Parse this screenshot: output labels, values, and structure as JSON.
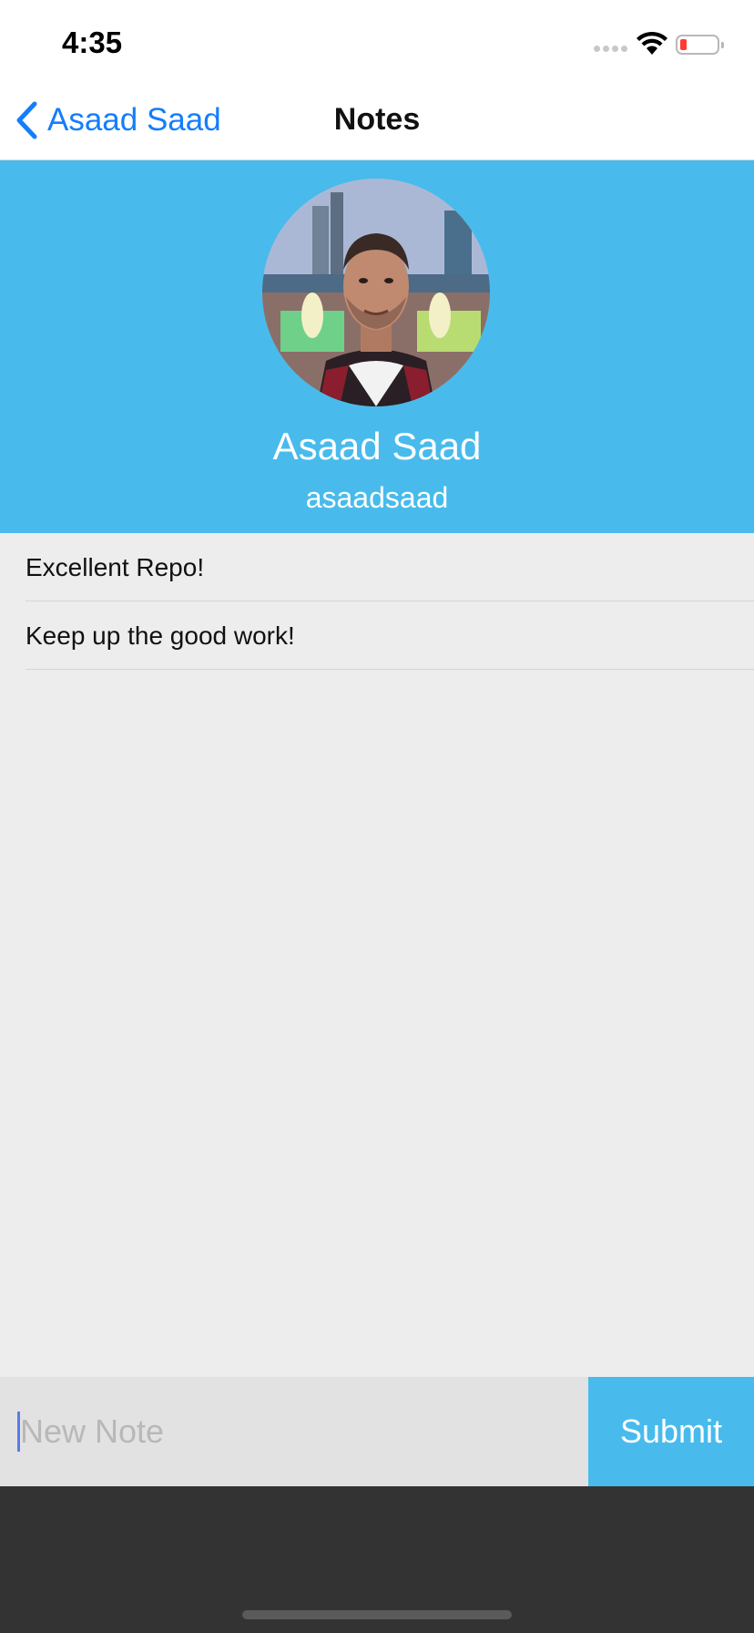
{
  "status_bar": {
    "time": "4:35",
    "icons": [
      "signal-dots-icon",
      "wifi-icon",
      "battery-low-icon"
    ]
  },
  "nav": {
    "back_label": "Asaad Saad",
    "back_icon": "chevron-left-icon",
    "title": "Notes"
  },
  "profile": {
    "name": "Asaad Saad",
    "username": "asaadsaad"
  },
  "notes": [
    {
      "text": "Excellent Repo!"
    },
    {
      "text": "Keep up the good work!"
    }
  ],
  "input": {
    "placeholder": "New Note",
    "value": ""
  },
  "submit_label": "Submit",
  "colors": {
    "accent": "#48bbec",
    "link": "#147efb",
    "list_bg": "#ededed",
    "input_bg": "#e2e2e2",
    "keyboard_bg": "#333333"
  }
}
